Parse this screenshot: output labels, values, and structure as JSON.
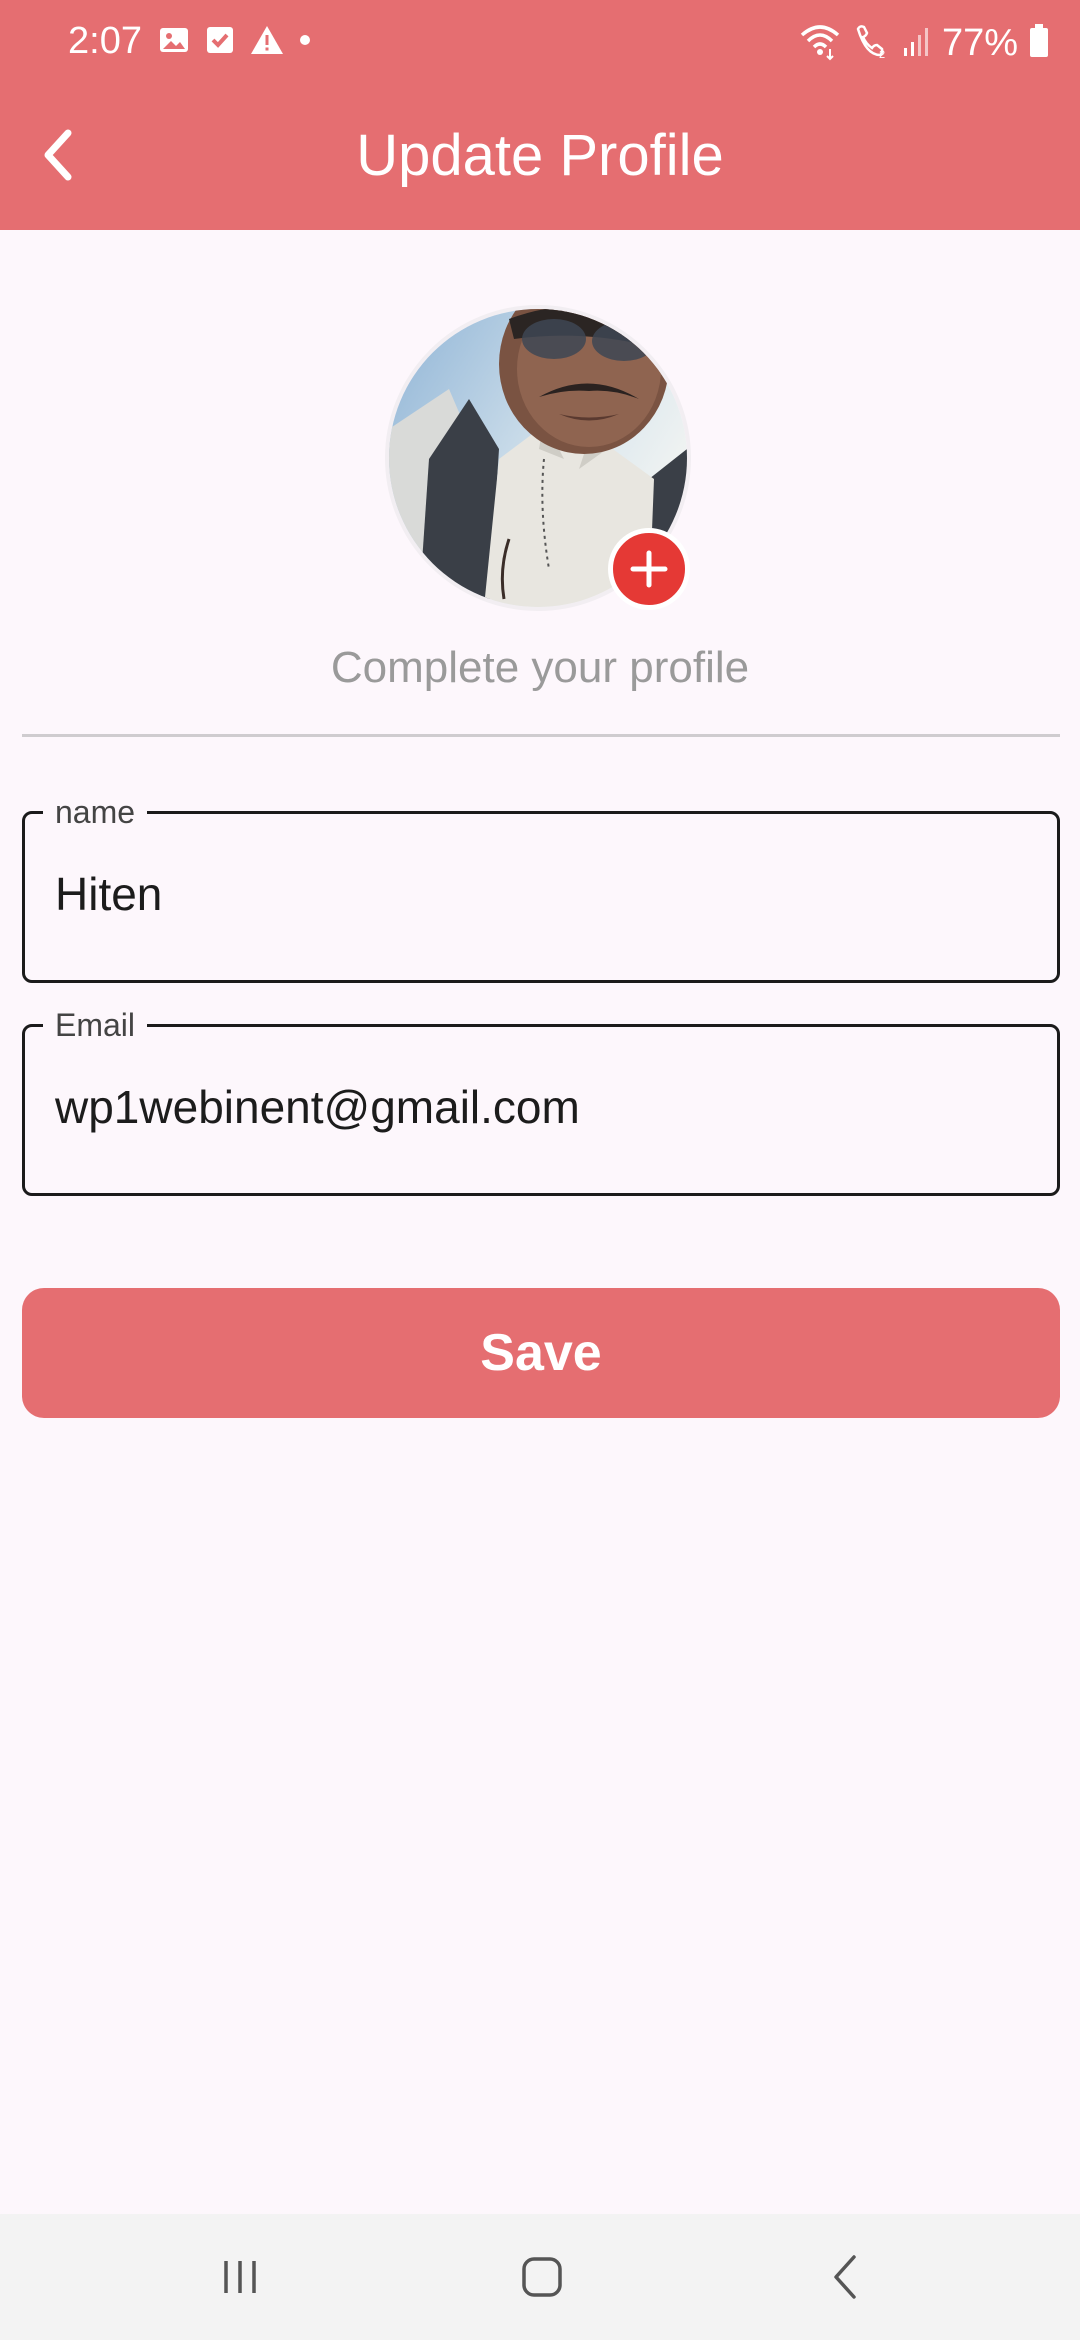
{
  "status_bar": {
    "time": "2:07",
    "battery": "77%",
    "left_icons": [
      "image-icon",
      "check-box-icon",
      "warning-icon",
      "dot-icon"
    ],
    "right_icons": [
      "wifi-icon",
      "wifi-calling-icon",
      "signal-icon",
      "battery-icon"
    ]
  },
  "header": {
    "title": "Update Profile",
    "back_icon": "chevron-left-icon",
    "background_color": "#e56e71"
  },
  "profile": {
    "subtitle": "Complete your profile",
    "add_photo_icon": "plus-icon",
    "add_photo_color": "#e53935"
  },
  "form": {
    "name_label": "name",
    "name_value": "Hiten",
    "email_label": "Email",
    "email_value": "wp1webinent@gmail.com",
    "save_label": "Save"
  },
  "nav_bar": {
    "icons": [
      "recents-icon",
      "home-icon",
      "back-icon"
    ]
  }
}
